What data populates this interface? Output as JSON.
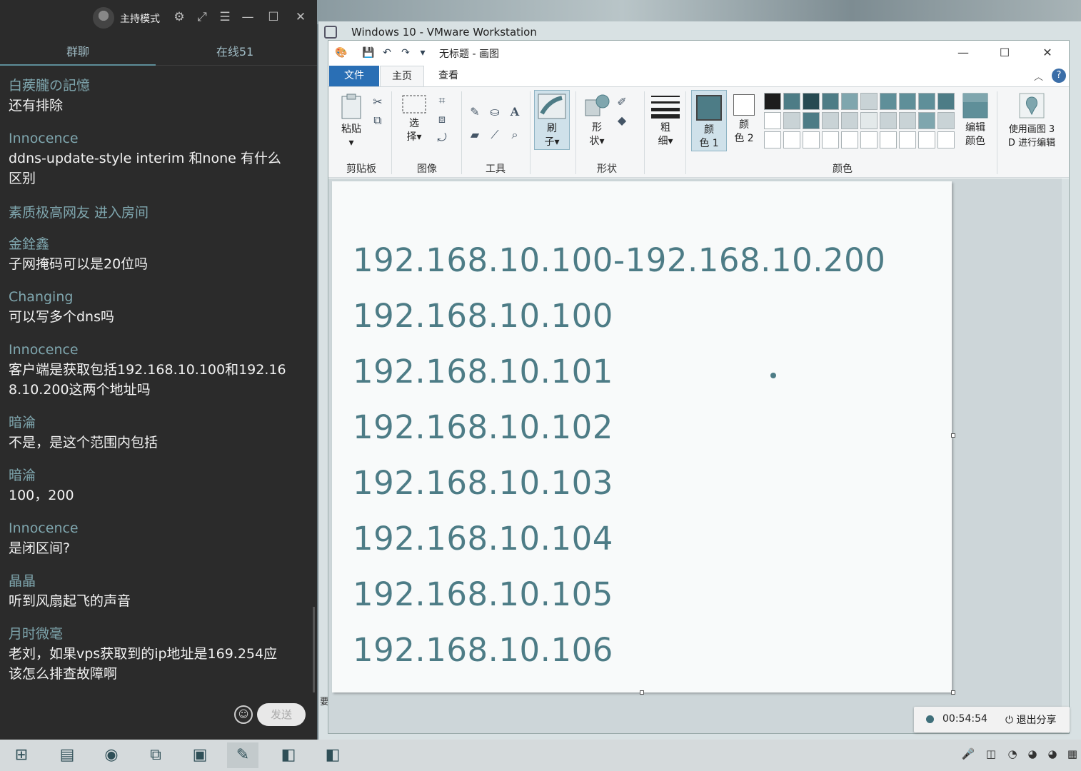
{
  "chat": {
    "mode_label": "主持模式",
    "tabs": [
      "群聊",
      "在线51"
    ],
    "messages": [
      {
        "name": "白蒺朧の記憶",
        "text": "还有排除"
      },
      {
        "name": "Innocence",
        "text": "ddns-update-style  interim 和none 有什么区别"
      },
      {
        "name": "素质极高网友 进入房间",
        "text": ""
      },
      {
        "name": "金銓鑫",
        "text": "子网掩码可以是20位吗"
      },
      {
        "name": "Changing",
        "text": "可以写多个dns吗"
      },
      {
        "name": "Innocence",
        "text": "客户端是获取包括192.168.10.100和192.168.10.200这两个地址吗"
      },
      {
        "name": "暗淪",
        "text": "不是，是这个范围内包括"
      },
      {
        "name": "暗淪",
        "text": "100，200"
      },
      {
        "name": "Innocence",
        "text": "是闭区间?"
      },
      {
        "name": "晶晶",
        "text": "听到风扇起飞的声音"
      },
      {
        "name": "月时微毫",
        "text": "老刘，如果vps获取到的ip地址是169.254应该怎么排查故障啊"
      }
    ],
    "send_label": "发送"
  },
  "vmware": {
    "title": "Windows 10 - VMware Workstation"
  },
  "paint": {
    "doc_title": "无标题 - 画图",
    "tabs": {
      "file": "文件",
      "home": "主页",
      "view": "查看"
    },
    "help": "?",
    "groups": {
      "clipboard": "剪贴板",
      "image": "图像",
      "tools": "工具",
      "shapes": "形状",
      "colors": "颜色"
    },
    "buttons": {
      "paste": "粘贴",
      "select_1": "选",
      "select_2": "择",
      "brush_1": "刷",
      "brush_2": "子",
      "shape_1": "形",
      "shape_2": "状",
      "size_1": "粗",
      "size_2": "细",
      "color1_1": "颜",
      "color1_2": "色 1",
      "color2_1": "颜",
      "color2_2": "色 2",
      "edit_colors_1": "编辑",
      "edit_colors_2": "颜色",
      "paint3d_1": "使用画图 3",
      "paint3d_2": "D 进行编辑"
    },
    "canvas_lines": [
      "192.168.10.100-192.168.10.200",
      "192.168.10.100",
      "192.168.10.101",
      "192.168.10.102",
      "192.168.10.103",
      "192.168.10.104",
      "192.168.10.105",
      "192.168.10.106"
    ],
    "palette_row1": [
      "#1d1d1d",
      "#4d7c86",
      "#274a52",
      "#4d7c86",
      "#7fa6ae",
      "#c9d3d6",
      "#5f8f99",
      "#5f8f99",
      "#5f8f99",
      "#4d7c86"
    ],
    "palette_row2": [
      "#ffffff",
      "#c9d3d6",
      "#4d7c86",
      "#c9d3d6",
      "#c9d3d6",
      "#e3e9ea",
      "#c9d3d6",
      "#c9d3d6",
      "#7fa6ae",
      "#c9d3d6"
    ],
    "color1": "#4d7c86",
    "color2": "#ffffff",
    "side_text": "要"
  },
  "share": {
    "time": "00:54:54",
    "exit_label": "退出分享"
  }
}
